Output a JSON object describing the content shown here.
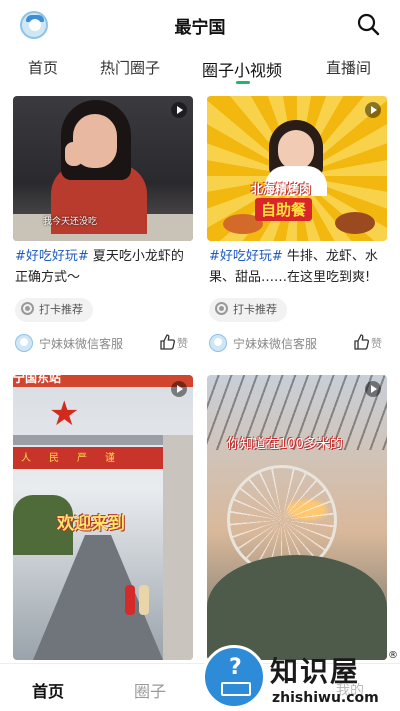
{
  "header": {
    "title": "最宁国",
    "avatar_icon": "app-logo-icon",
    "search_icon": "search-icon"
  },
  "tabs": [
    {
      "label": "首页",
      "active": false
    },
    {
      "label": "热门圈子",
      "active": false
    },
    {
      "label": "圈子小视频",
      "active": true
    },
    {
      "label": "直播间",
      "active": false
    }
  ],
  "accent_color": "#1fb76a",
  "tag_color": "#1e5bbd",
  "cards": [
    {
      "subtitle": "我今天还没吃",
      "tag": "#好吃好玩#",
      "text": " 夏天吃小龙虾的正确方式～",
      "checkin": "打卡推荐",
      "author": "宁妹妹微信客服",
      "like": "赞"
    },
    {
      "banner": "北海精烤肉",
      "big_text": "自助餐",
      "tag": "#好吃好玩#",
      "text": " 牛排、龙虾、水果、甜品……在这里吃到爽!",
      "checkin": "打卡推荐",
      "author": "宁妹妹微信客服",
      "like": "赞"
    },
    {
      "gate_text": "宁国东站",
      "sign_text": "人民严谨",
      "welcome": "欢迎来到"
    },
    {
      "caption": "你知道在100多米的"
    }
  ],
  "bottom_nav": [
    {
      "label": "首页",
      "active": true
    },
    {
      "label": "圈子",
      "active": false
    },
    {
      "label": "我的",
      "active": false
    }
  ],
  "watermark": {
    "cn": "知识屋",
    "reg": "®",
    "en": "zhishiwu.com"
  }
}
